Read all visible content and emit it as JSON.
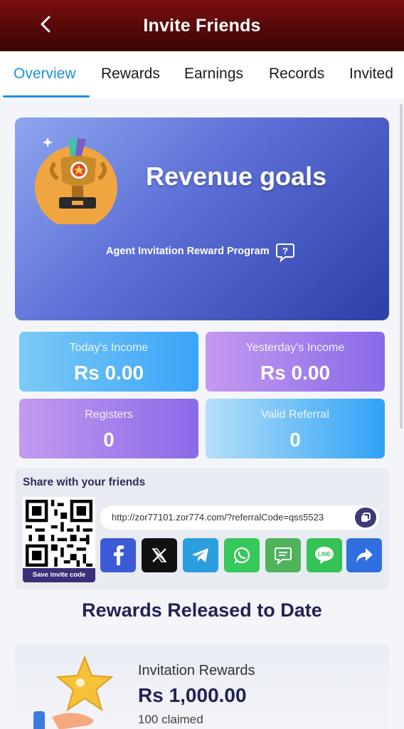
{
  "header": {
    "title": "Invite Friends",
    "back_icon": "chevron-left-icon"
  },
  "tabs": [
    {
      "label": "Overview",
      "active": true
    },
    {
      "label": "Rewards",
      "active": false
    },
    {
      "label": "Earnings",
      "active": false
    },
    {
      "label": "Records",
      "active": false
    },
    {
      "label": "Invited",
      "active": false
    }
  ],
  "hero": {
    "title": "Revenue goals",
    "subtitle": "Agent Invitation Reward Program",
    "icon": "trophy-icon",
    "help_icon": "question-bubble-icon"
  },
  "stats": {
    "today": {
      "label": "Today's Income",
      "value": "Rs  0.00"
    },
    "yesterday": {
      "label": "Yesterday's Income",
      "value": "Rs  0.00"
    },
    "registers": {
      "label": "Registers",
      "value": "0"
    },
    "valid_referral": {
      "label": "Valid Referral",
      "value": "0"
    }
  },
  "share": {
    "title": "Share with your friends",
    "save_label": "Save invite code",
    "link": "http://zor77101.zor774.com/?referralCode=qss5523",
    "socials": [
      "facebook-icon",
      "x-icon",
      "telegram-icon",
      "whatsapp-icon",
      "message-icon",
      "line-icon",
      "share-icon"
    ]
  },
  "released": {
    "title": "Rewards Released to Date"
  },
  "reward": {
    "label": "Invitation Rewards",
    "amount": "Rs  1,000.00",
    "claimed": "100 claimed"
  },
  "colors": {
    "header": "#5a0909",
    "accent": "#1e8fe0",
    "navy": "#1e2358"
  }
}
